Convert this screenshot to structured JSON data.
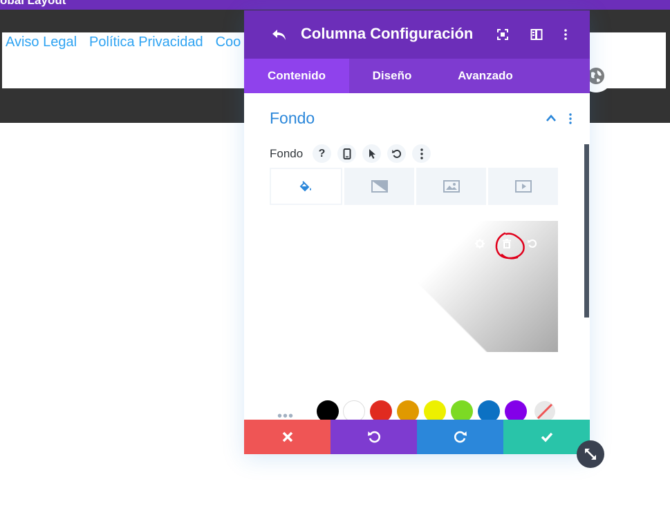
{
  "page": {
    "top_title": "obal Layout",
    "footer_links": [
      "Aviso Legal",
      "Política Privacidad",
      "Coo"
    ]
  },
  "modal": {
    "title": "Columna Configuración",
    "tabs": [
      {
        "label": "Contenido",
        "active": true
      },
      {
        "label": "Diseño",
        "active": false
      },
      {
        "label": "Avanzado",
        "active": false
      }
    ],
    "section_title": "Fondo",
    "field_label": "Fondo",
    "field_help": "?",
    "bg_tabs": [
      "color-fill-icon",
      "gradient-icon",
      "image-icon",
      "video-icon"
    ],
    "preview_icons": [
      "gear-icon",
      "trash-icon",
      "reset-icon"
    ],
    "swatch_more": "•••",
    "swatches": [
      "#000000",
      "#ffffff",
      "#e02b20",
      "#e09900",
      "#edf000",
      "#7cda24",
      "#0c71c3",
      "#8300e9"
    ],
    "footer_buttons": [
      {
        "name": "cancel",
        "color": "#ef5555"
      },
      {
        "name": "undo",
        "color": "#7e3bd0"
      },
      {
        "name": "redo",
        "color": "#2b87da"
      },
      {
        "name": "save",
        "color": "#29c4a9"
      }
    ]
  },
  "colors": {
    "header": "#6c2eb9",
    "tabs": "#7e3bd0",
    "active_tab": "#8f42ec",
    "accent_blue": "#2b87da",
    "link_blue": "#2ea3f2",
    "annotation": "#e0001b"
  }
}
